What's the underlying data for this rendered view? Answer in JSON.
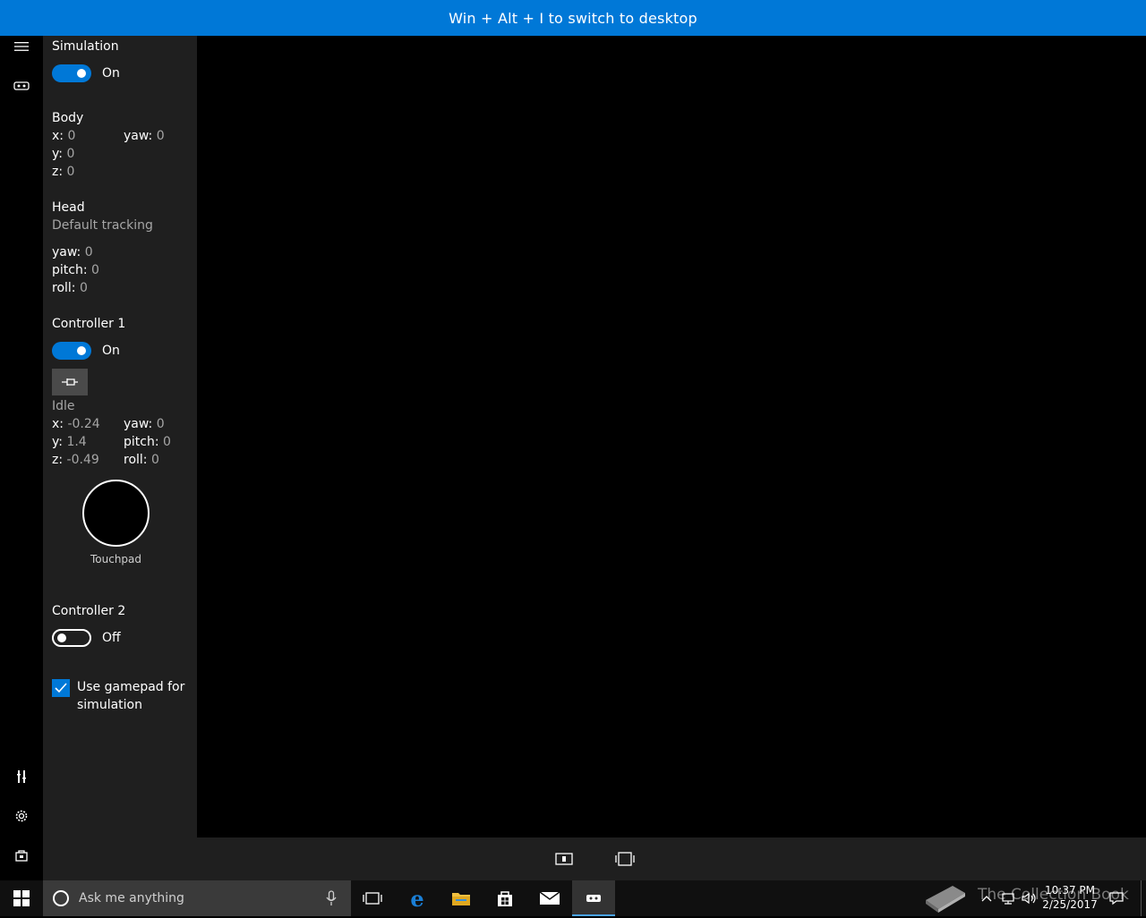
{
  "topbar": {
    "text": "Win + Alt + I to switch to desktop"
  },
  "rail": {
    "icons": [
      "hamburger-menu-icon",
      "headset-icon",
      "tools-icon",
      "gear-icon",
      "store-icon"
    ]
  },
  "simulation": {
    "heading": "Simulation",
    "state": "On"
  },
  "body": {
    "heading": "Body",
    "x_label": "x:",
    "x": "0",
    "y_label": "y:",
    "y": "0",
    "z_label": "z:",
    "z": "0",
    "yaw_label": "yaw:",
    "yaw": "0"
  },
  "head": {
    "heading": "Head",
    "mode": "Default tracking",
    "yaw_label": "yaw:",
    "yaw": "0",
    "pitch_label": "pitch:",
    "pitch": "0",
    "roll_label": "roll:",
    "roll": "0"
  },
  "controller1": {
    "heading": "Controller 1",
    "state": "On",
    "status": "Idle",
    "x_label": "x:",
    "x": "-0.24",
    "y_label": "y:",
    "y": "1.4",
    "z_label": "z:",
    "z": "-0.49",
    "yaw_label": "yaw:",
    "yaw": "0",
    "pitch_label": "pitch:",
    "pitch": "0",
    "roll_label": "roll:",
    "roll": "0",
    "touchpad_label": "Touchpad"
  },
  "controller2": {
    "heading": "Controller 2",
    "state": "Off"
  },
  "gamepad": {
    "label_line1": "Use gamepad for",
    "label_line2": "simulation",
    "checked": true
  },
  "taskbar": {
    "search_placeholder": "Ask me anything",
    "watermark": "The Collection Book",
    "time": "10:37 PM",
    "date": "2/25/2017"
  },
  "colors": {
    "accent": "#0078d7",
    "panel": "#1f1f1f",
    "muted": "#a6a6a6"
  }
}
